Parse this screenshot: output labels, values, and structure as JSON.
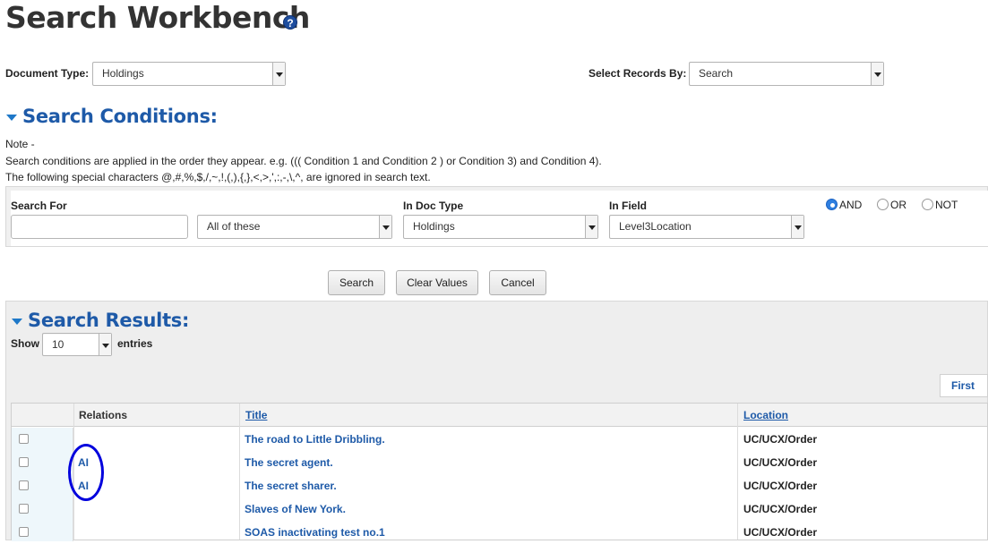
{
  "page": {
    "title": "Search Workbench",
    "help_icon": "?"
  },
  "filters": {
    "document_type_label": "Document Type:",
    "document_type_value": "Holdings",
    "select_records_label": "Select Records By:",
    "select_records_value": "Search"
  },
  "conditions": {
    "heading": "Search Conditions:",
    "note_label": "Note -",
    "note_line1": "Search conditions are applied in the order they appear. e.g. ((( Condition 1 and Condition 2 ) or Condition 3) and Condition 4).",
    "note_line2": "The following special characters @,#,%,$,/,~,!,(,),{,},<,>,',:,-,\\,^, are ignored in search text.",
    "search_for_label": "Search For",
    "search_for_value": "",
    "match_value": "All of these",
    "in_doc_type_label": "In Doc Type",
    "in_doc_type_value": "Holdings",
    "in_field_label": "In Field",
    "in_field_value": "Level3Location",
    "operators": [
      {
        "label": "AND",
        "selected": true
      },
      {
        "label": "OR",
        "selected": false
      },
      {
        "label": "NOT",
        "selected": false
      }
    ]
  },
  "actions": {
    "search": "Search",
    "clear": "Clear Values",
    "cancel": "Cancel"
  },
  "results": {
    "heading": "Search Results:",
    "show_label": "Show",
    "show_value": "10",
    "entries_label": "entries",
    "first_label": "First",
    "columns": {
      "relations": "Relations",
      "title": "Title",
      "location": "Location"
    },
    "rows": [
      {
        "relations": "",
        "title": "The road to Little Dribbling.",
        "location": "UC/UCX/Order"
      },
      {
        "relations": "AI",
        "title": "The secret agent.",
        "location": "UC/UCX/Order"
      },
      {
        "relations": "AI",
        "title": "The secret sharer.",
        "location": "UC/UCX/Order"
      },
      {
        "relations": "",
        "title": "Slaves of New York.",
        "location": "UC/UCX/Order"
      },
      {
        "relations": "",
        "title": "SOAS inactivating test no.1",
        "location": "UC/UCX/Order"
      }
    ]
  },
  "colors": {
    "accent": "#1e5aa8",
    "annotation_oval": "#0000dd"
  }
}
